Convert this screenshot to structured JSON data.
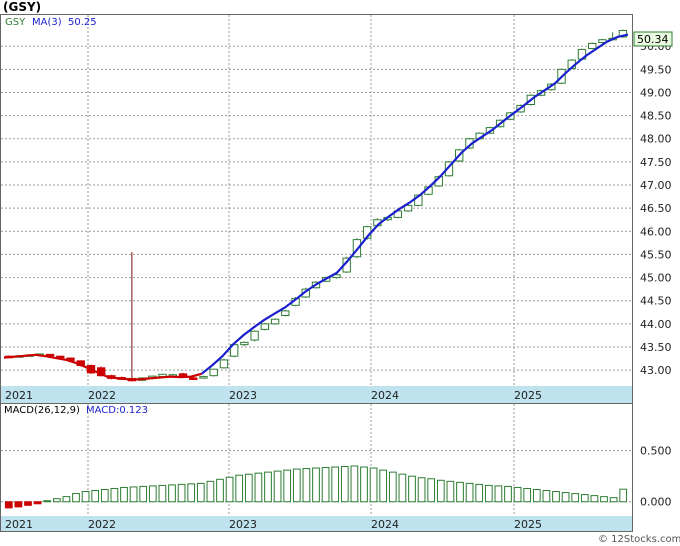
{
  "title": "(GSY)",
  "legend": {
    "ticker": "GSY",
    "ma_label": "MA(3)",
    "ma_value": "50.25"
  },
  "last_price_badge": "50.34",
  "macd_legend": {
    "label": "MACD(26,12,9)",
    "value_label": "MACD:0.123"
  },
  "watermark": "© 12Stocks.com",
  "colors": {
    "up": "#2e7d32",
    "down": "#cc0000",
    "ma": "#1a1fd0",
    "ma_early": "#cc0000",
    "axis_band": "#bfe3ee",
    "badge_bg": "#e9fbe0",
    "grid": "#9a9a9a"
  },
  "chart_data": [
    {
      "type": "candlestick",
      "title": "(GSY)",
      "x_labels": [
        "2021",
        "2022",
        "2023",
        "2024",
        "2025"
      ],
      "y_ticks": [
        "50.00",
        "49.50",
        "49.00",
        "48.50",
        "48.00",
        "47.50",
        "47.00",
        "46.50",
        "46.00",
        "45.50",
        "45.00",
        "44.50",
        "44.00",
        "43.50",
        "43.00"
      ],
      "ylim": [
        42.7,
        50.35
      ],
      "grid": true,
      "series": [
        {
          "name": "MA(3)",
          "values": [
            43.27,
            43.29,
            43.31,
            43.33,
            43.3,
            43.26,
            43.22,
            43.15,
            43.05,
            42.95,
            42.85,
            42.82,
            42.8,
            42.8,
            42.82,
            42.84,
            42.86,
            42.85,
            42.86,
            42.92,
            43.1,
            43.3,
            43.55,
            43.75,
            43.92,
            44.08,
            44.22,
            44.35,
            44.52,
            44.7,
            44.85,
            44.98,
            45.1,
            45.35,
            45.62,
            45.9,
            46.15,
            46.32,
            46.48,
            46.62,
            46.78,
            46.98,
            47.2,
            47.45,
            47.7,
            47.9,
            48.05,
            48.2,
            48.38,
            48.55,
            48.72,
            48.9,
            49.05,
            49.2,
            49.42,
            49.62,
            49.8,
            49.95,
            50.1,
            50.2,
            50.25
          ]
        }
      ],
      "candles": [
        {
          "o": 43.3,
          "h": 43.32,
          "l": 43.28,
          "c": 43.29
        },
        {
          "o": 43.3,
          "h": 43.32,
          "l": 43.28,
          "c": 43.31
        },
        {
          "o": 43.32,
          "h": 43.34,
          "l": 43.3,
          "c": 43.33
        },
        {
          "o": 43.34,
          "h": 43.36,
          "l": 43.32,
          "c": 43.35
        },
        {
          "o": 43.34,
          "h": 43.35,
          "l": 43.3,
          "c": 43.31
        },
        {
          "o": 43.3,
          "h": 43.31,
          "l": 43.26,
          "c": 43.27
        },
        {
          "o": 43.26,
          "h": 43.27,
          "l": 43.2,
          "c": 43.21
        },
        {
          "o": 43.2,
          "h": 43.21,
          "l": 43.08,
          "c": 43.1
        },
        {
          "o": 43.1,
          "h": 43.12,
          "l": 42.92,
          "c": 42.94
        },
        {
          "o": 43.05,
          "h": 43.08,
          "l": 42.86,
          "c": 42.88
        },
        {
          "o": 42.88,
          "h": 42.9,
          "l": 42.8,
          "c": 42.82
        },
        {
          "o": 42.84,
          "h": 42.86,
          "l": 42.79,
          "c": 42.8
        },
        {
          "o": 42.82,
          "h": 45.55,
          "l": 42.76,
          "c": 42.77
        },
        {
          "o": 42.78,
          "h": 42.84,
          "l": 42.76,
          "c": 42.83
        },
        {
          "o": 42.82,
          "h": 42.88,
          "l": 42.8,
          "c": 42.87
        },
        {
          "o": 42.86,
          "h": 42.92,
          "l": 42.84,
          "c": 42.91
        },
        {
          "o": 42.88,
          "h": 42.92,
          "l": 42.85,
          "c": 42.9
        },
        {
          "o": 42.92,
          "h": 42.94,
          "l": 42.84,
          "c": 42.86
        },
        {
          "o": 42.83,
          "h": 42.86,
          "l": 42.8,
          "c": 42.82
        },
        {
          "o": 42.84,
          "h": 42.88,
          "l": 42.82,
          "c": 42.86
        },
        {
          "o": 42.88,
          "h": 43.03,
          "l": 42.86,
          "c": 43.02
        },
        {
          "o": 43.05,
          "h": 43.25,
          "l": 43.03,
          "c": 43.22
        },
        {
          "o": 43.3,
          "h": 43.56,
          "l": 43.28,
          "c": 43.55
        },
        {
          "o": 43.55,
          "h": 43.62,
          "l": 43.52,
          "c": 43.6
        },
        {
          "o": 43.65,
          "h": 43.86,
          "l": 43.62,
          "c": 43.84
        },
        {
          "o": 43.88,
          "h": 44.02,
          "l": 43.86,
          "c": 44.0
        },
        {
          "o": 44.0,
          "h": 44.12,
          "l": 43.98,
          "c": 44.1
        },
        {
          "o": 44.18,
          "h": 44.3,
          "l": 44.16,
          "c": 44.28
        },
        {
          "o": 44.4,
          "h": 44.58,
          "l": 44.38,
          "c": 44.55
        },
        {
          "o": 44.58,
          "h": 44.78,
          "l": 44.56,
          "c": 44.75
        },
        {
          "o": 44.78,
          "h": 44.92,
          "l": 44.76,
          "c": 44.9
        },
        {
          "o": 44.92,
          "h": 45.02,
          "l": 44.9,
          "c": 45.0
        },
        {
          "o": 45.0,
          "h": 45.08,
          "l": 44.98,
          "c": 45.06
        },
        {
          "o": 45.12,
          "h": 45.45,
          "l": 45.1,
          "c": 45.42
        },
        {
          "o": 45.45,
          "h": 45.85,
          "l": 45.42,
          "c": 45.82
        },
        {
          "o": 45.85,
          "h": 46.12,
          "l": 45.82,
          "c": 46.1
        },
        {
          "o": 46.12,
          "h": 46.28,
          "l": 46.1,
          "c": 46.25
        },
        {
          "o": 46.25,
          "h": 46.32,
          "l": 46.22,
          "c": 46.3
        },
        {
          "o": 46.3,
          "h": 46.46,
          "l": 46.28,
          "c": 46.44
        },
        {
          "o": 46.44,
          "h": 46.58,
          "l": 46.42,
          "c": 46.56
        },
        {
          "o": 46.56,
          "h": 46.8,
          "l": 46.54,
          "c": 46.78
        },
        {
          "o": 46.8,
          "h": 46.98,
          "l": 46.78,
          "c": 46.96
        },
        {
          "o": 46.98,
          "h": 47.2,
          "l": 46.96,
          "c": 47.18
        },
        {
          "o": 47.2,
          "h": 47.52,
          "l": 47.18,
          "c": 47.5
        },
        {
          "o": 47.52,
          "h": 47.78,
          "l": 47.5,
          "c": 47.76
        },
        {
          "o": 47.8,
          "h": 48.02,
          "l": 47.78,
          "c": 48.0
        },
        {
          "o": 48.0,
          "h": 48.14,
          "l": 47.98,
          "c": 48.12
        },
        {
          "o": 48.12,
          "h": 48.26,
          "l": 48.1,
          "c": 48.24
        },
        {
          "o": 48.26,
          "h": 48.42,
          "l": 48.24,
          "c": 48.4
        },
        {
          "o": 48.42,
          "h": 48.58,
          "l": 48.4,
          "c": 48.56
        },
        {
          "o": 48.58,
          "h": 48.74,
          "l": 48.56,
          "c": 48.72
        },
        {
          "o": 48.74,
          "h": 48.96,
          "l": 48.72,
          "c": 48.94
        },
        {
          "o": 48.94,
          "h": 49.06,
          "l": 48.92,
          "c": 49.04
        },
        {
          "o": 49.06,
          "h": 49.2,
          "l": 49.04,
          "c": 49.18
        },
        {
          "o": 49.2,
          "h": 49.52,
          "l": 49.18,
          "c": 49.5
        },
        {
          "o": 49.52,
          "h": 49.72,
          "l": 49.5,
          "c": 49.7
        },
        {
          "o": 49.72,
          "h": 49.95,
          "l": 49.7,
          "c": 49.93
        },
        {
          "o": 49.95,
          "h": 50.08,
          "l": 49.93,
          "c": 50.06
        },
        {
          "o": 50.08,
          "h": 50.16,
          "l": 50.06,
          "c": 50.14
        },
        {
          "o": 50.16,
          "h": 50.3,
          "l": 50.14,
          "c": 50.17
        },
        {
          "o": 50.2,
          "h": 50.36,
          "l": 50.18,
          "c": 50.34
        }
      ]
    },
    {
      "type": "bar",
      "title": "MACD(26,12,9)",
      "x_labels": [
        "2021",
        "2022",
        "2023",
        "2024",
        "2025"
      ],
      "y_ticks": [
        "0.500",
        "0.000"
      ],
      "ylim": [
        -0.12,
        0.82
      ],
      "values": [
        -0.06,
        -0.05,
        -0.035,
        -0.02,
        0.01,
        0.03,
        0.05,
        0.08,
        0.1,
        0.11,
        0.12,
        0.13,
        0.14,
        0.145,
        0.15,
        0.155,
        0.16,
        0.165,
        0.17,
        0.175,
        0.18,
        0.2,
        0.22,
        0.24,
        0.26,
        0.27,
        0.28,
        0.29,
        0.3,
        0.31,
        0.32,
        0.325,
        0.33,
        0.335,
        0.34,
        0.345,
        0.35,
        0.34,
        0.33,
        0.31,
        0.29,
        0.27,
        0.25,
        0.235,
        0.225,
        0.21,
        0.2,
        0.19,
        0.18,
        0.17,
        0.16,
        0.155,
        0.15,
        0.14,
        0.13,
        0.12,
        0.11,
        0.1,
        0.09,
        0.08,
        0.07,
        0.06,
        0.05,
        0.04,
        0.123
      ]
    }
  ]
}
